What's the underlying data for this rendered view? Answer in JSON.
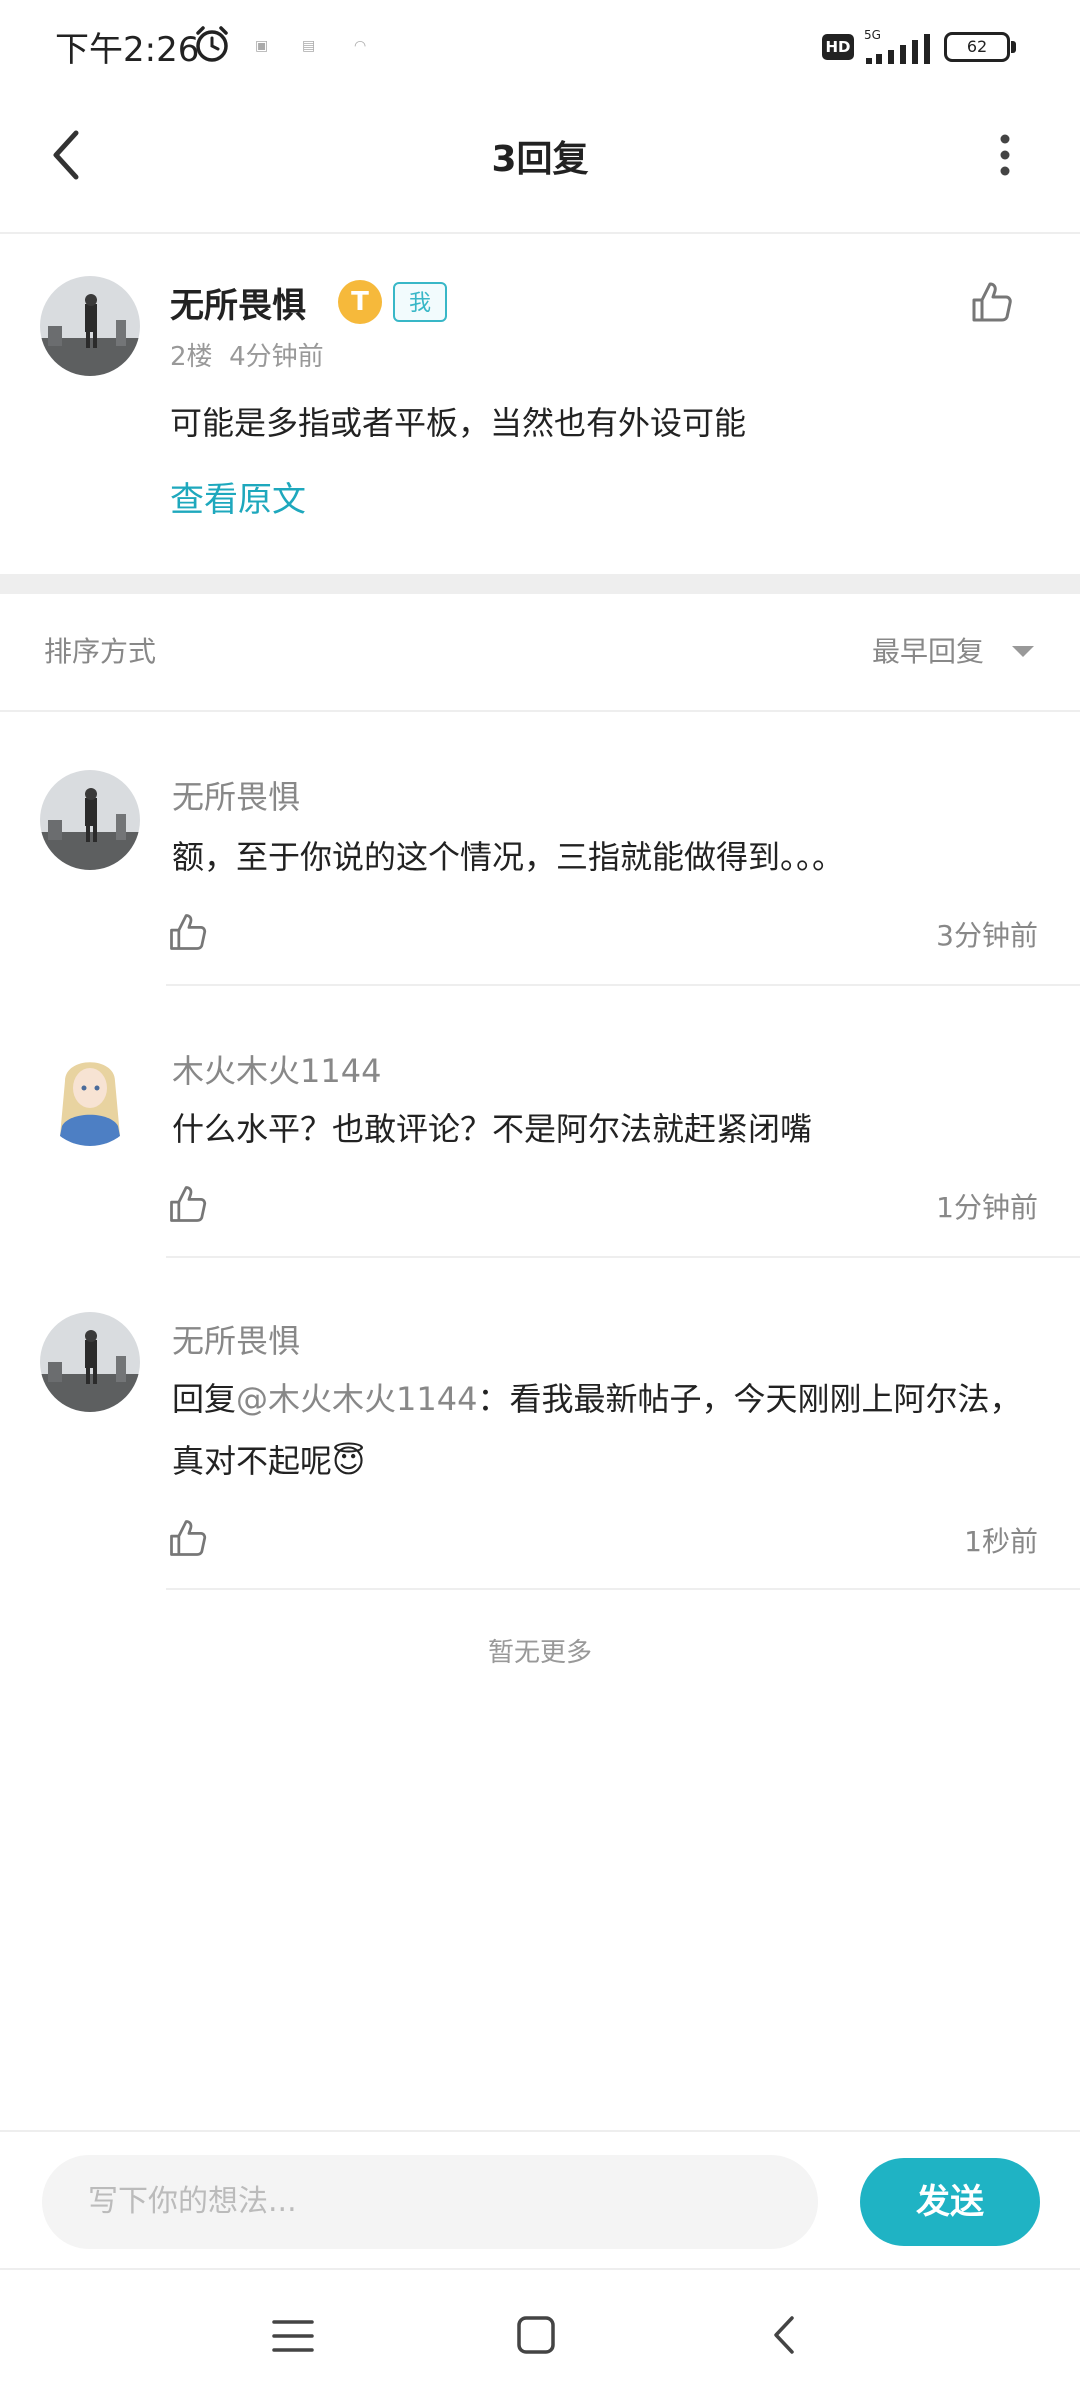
{
  "status_bar": {
    "time": "下午2:26",
    "network": "5G",
    "hd": "HD",
    "battery": "62"
  },
  "header": {
    "title": "3回复"
  },
  "post": {
    "author": "无所畏惧",
    "badge_level": "T",
    "badge_me": "我",
    "meta": "2楼  4分钟前",
    "content": "可能是多指或者平板，当然也有外设可能",
    "view_original": "查看原文"
  },
  "sort": {
    "label": "排序方式",
    "value": "最早回复"
  },
  "replies": [
    {
      "name": "无所畏惧",
      "text": "额，至于你说的这个情况，三指就能做得到。。。",
      "time": "3分钟前"
    },
    {
      "name": "木火木火1144",
      "text": "什么水平？也敢评论？不是阿尔法就赶紧闭嘴",
      "time": "1分钟前"
    },
    {
      "name": "无所畏惧",
      "text_prefix": "回复",
      "mention": "@木火木火1144",
      "text_suffix": "：看我最新帖子，今天刚刚上阿尔法，真对不起呢",
      "emoji": "😇",
      "time": "1秒前"
    }
  ],
  "no_more": "暂无更多",
  "composer": {
    "placeholder": "写下你的想法...",
    "send_label": "发送"
  },
  "colors": {
    "accent": "#1fb3c4",
    "link": "#1ea8bd"
  }
}
